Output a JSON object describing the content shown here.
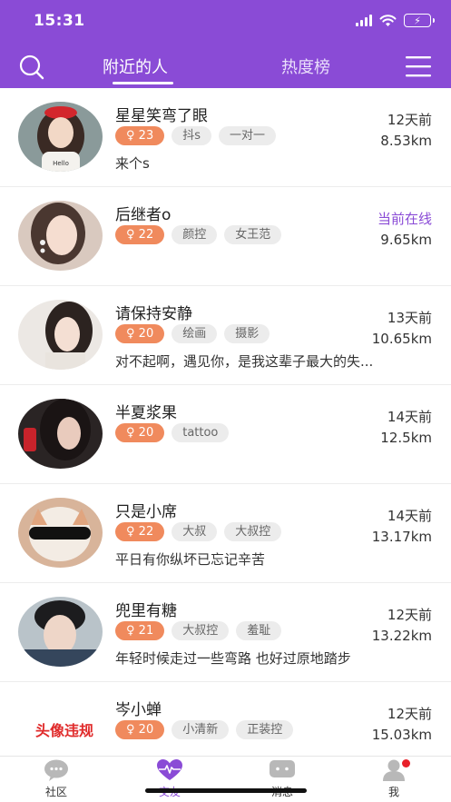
{
  "status_bar": {
    "time": "15:31"
  },
  "header": {
    "tabs": [
      {
        "label": "附近的人",
        "active": true
      },
      {
        "label": "热度榜",
        "active": false
      }
    ],
    "accent_color": "#8a4bd6"
  },
  "users": [
    {
      "name": "星星笑弯了眼",
      "age": "23",
      "tags": [
        "抖s",
        "一对一"
      ],
      "bio": "来个s",
      "time": "12天前",
      "distance": "8.53km",
      "online": false,
      "avatar_text": ""
    },
    {
      "name": "后继者o",
      "age": "22",
      "tags": [
        "颜控",
        "女王范"
      ],
      "bio": "",
      "time": "当前在线",
      "distance": "9.65km",
      "online": true,
      "avatar_text": ""
    },
    {
      "name": "请保持安静",
      "age": "20",
      "tags": [
        "绘画",
        "摄影"
      ],
      "bio": "对不起啊，遇见你，是我这辈子最大的失...",
      "time": "13天前",
      "distance": "10.65km",
      "online": false,
      "avatar_text": ""
    },
    {
      "name": "半夏浆果",
      "age": "20",
      "tags": [
        "tattoo"
      ],
      "bio": "",
      "time": "14天前",
      "distance": "12.5km",
      "online": false,
      "avatar_text": ""
    },
    {
      "name": "只是小席",
      "age": "22",
      "tags": [
        "大叔",
        "大叔控"
      ],
      "bio": "平日有你纵坏已忘记辛苦",
      "time": "14天前",
      "distance": "13.17km",
      "online": false,
      "avatar_text": ""
    },
    {
      "name": "兜里有糖",
      "age": "21",
      "tags": [
        "大叔控",
        "羞耻"
      ],
      "bio": "年轻时候走过一些弯路 也好过原地踏步",
      "time": "12天前",
      "distance": "13.22km",
      "online": false,
      "avatar_text": ""
    },
    {
      "name": "岑小蝉",
      "age": "20",
      "tags": [
        "小清新",
        "正装控"
      ],
      "bio": "",
      "time": "12天前",
      "distance": "15.03km",
      "online": false,
      "avatar_text": "头像违规"
    }
  ],
  "tabbar": {
    "items": [
      {
        "label": "社区",
        "icon": "chat-bubble-icon"
      },
      {
        "label": "交友",
        "icon": "heart-pulse-icon"
      },
      {
        "label": "消息",
        "icon": "message-icon"
      },
      {
        "label": "我",
        "icon": "profile-icon"
      }
    ]
  }
}
